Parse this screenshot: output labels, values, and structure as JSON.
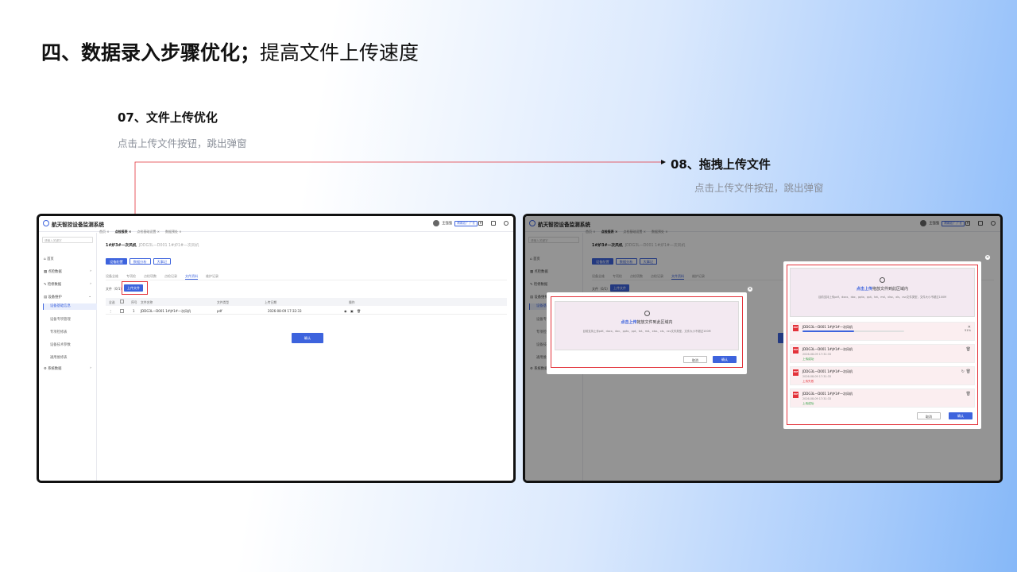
{
  "page": {
    "title_bold": "四、数据录入步骤优化；",
    "title_normal": "提高文件上传速度"
  },
  "step07": {
    "heading": "07、文件上传优化",
    "sub": "点击上传文件按钮，跳出弹窗"
  },
  "step08": {
    "heading": "08、拖拽上传文件",
    "sub": "点击上传文件按钮，跳出弹窗"
  },
  "colors": {
    "accent": "#3d63dd",
    "highlight": "#e3323a"
  },
  "app": {
    "name": "航天智控设备监测系统",
    "nav_tabs": [
      "首页 ×",
      "点检报表 ×",
      "点检基础设置 ×",
      "数据预处 ×"
    ],
    "user_name": "王强强",
    "user_role": "靖城北厂 厂长",
    "search_placeholder": "请输入关键字",
    "sidebar": [
      "首页",
      "点检数据",
      "检修数据",
      "设备维护",
      "设备基础信息",
      "设备专项管理",
      "专项检修表",
      "设备技术参数",
      "通用维修表",
      "系统数据"
    ],
    "breadcrumb_main": "1#炉3#一次风机",
    "breadcrumb_path": "JDDG3L—D001 1#炉1#一次风机",
    "buttons": [
      "设备配置",
      "数据分析",
      "大事记"
    ],
    "subtabs": [
      "设备全维",
      "专项检",
      "点检项数",
      "点检记录",
      "文件资料",
      "维护记录"
    ],
    "file_count": "文件（0/1）",
    "upload_btn": "上传文件",
    "table_headers": [
      "全选",
      "",
      "序号",
      "文件名称",
      "文件类型",
      "上传日期",
      "操作"
    ],
    "table_row": {
      "index": "1",
      "name": "JDDG3L—D001 1#炉1#一次风机",
      "type": "pdf",
      "date": "2026-08-09 17:32:33"
    },
    "confirm": "确认"
  },
  "modal_small": {
    "upload_link": "点击上传",
    "upload_rest": "拖放文件到此区域内",
    "note": "目前支持上传pdf、docx、doc、pptx、ppt、txt、md、xlsx、xls、csv文件类型，文件大小不超过100M",
    "cancel": "取消",
    "ok": "确认"
  },
  "modal_large": {
    "upload_link": "点击上传",
    "upload_rest": "拖放文件到此区域内",
    "note": "目前支持上传pdf、docx、doc、pptx、ppt、txt、md、xlsx、xls、csv文件类型，文件大小不超过100M",
    "files": [
      {
        "name": "JDDG3L—D001 1#炉1#一次风机",
        "progress": 0.51,
        "pct": "51%",
        "date": "",
        "status": ""
      },
      {
        "name": "JDDG3L—D001 1#炉1#一次风机",
        "date": "2026-08-09 17:31:33",
        "status": "上传成功",
        "ok": true
      },
      {
        "name": "JDDG3L—D001 1#炉1#一次风机",
        "date": "2026-08-09 17:31:33",
        "status": "上传失败",
        "ok": false
      },
      {
        "name": "JDDG3L—D001 1#炉1#一次风机",
        "date": "2026-08-09 17:31:33",
        "status": "上传成功",
        "ok": true
      }
    ],
    "cancel": "取消",
    "ok": "确认"
  }
}
